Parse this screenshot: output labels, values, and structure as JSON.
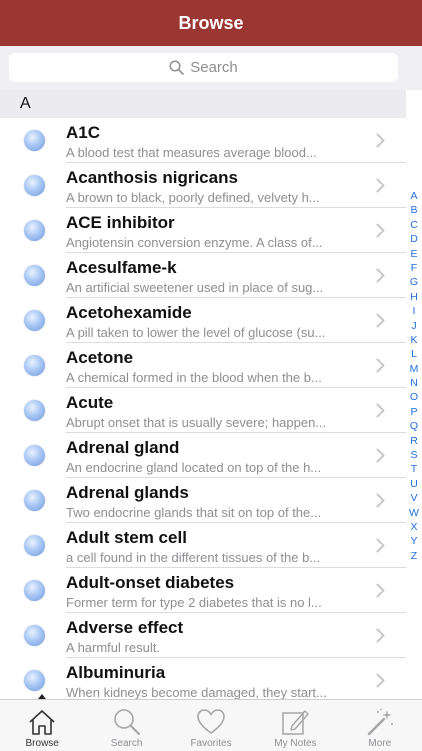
{
  "navbar": {
    "title": "Browse"
  },
  "search": {
    "placeholder": "Search"
  },
  "section": {
    "letter": "A"
  },
  "entries": [
    {
      "term": "A1C",
      "definition": "A blood test that measures average blood..."
    },
    {
      "term": "Acanthosis nigricans",
      "definition": "A brown to black, poorly defined, velvety h..."
    },
    {
      "term": "ACE inhibitor",
      "definition": "Angiotensin conversion enzyme. A class of..."
    },
    {
      "term": "Acesulfame-k",
      "definition": "An artificial sweetener used in place of sug..."
    },
    {
      "term": "Acetohexamide",
      "definition": "A pill taken to lower the level of glucose (su..."
    },
    {
      "term": "Acetone",
      "definition": "A chemical formed in the blood when the b..."
    },
    {
      "term": "Acute",
      "definition": "Abrupt onset that is usually severe; happen..."
    },
    {
      "term": "Adrenal gland",
      "definition": "An endocrine gland located on top of the h..."
    },
    {
      "term": "Adrenal glands",
      "definition": "Two endocrine glands that sit on top of the..."
    },
    {
      "term": "Adult stem cell",
      "definition": "a cell found in the different tissues of the b..."
    },
    {
      "term": "Adult-onset diabetes",
      "definition": "Former term for type 2 diabetes that is no l..."
    },
    {
      "term": "Adverse effect",
      "definition": "A harmful result."
    },
    {
      "term": "Albuminuria",
      "definition": "When kidneys become damaged, they start..."
    }
  ],
  "index_letters": [
    "A",
    "B",
    "C",
    "D",
    "E",
    "F",
    "G",
    "H",
    "I",
    "J",
    "K",
    "L",
    "M",
    "N",
    "O",
    "P",
    "Q",
    "R",
    "S",
    "T",
    "U",
    "V",
    "W",
    "X",
    "Y",
    "Z"
  ],
  "tabs": [
    {
      "label": "Browse",
      "icon": "home-icon",
      "active": true
    },
    {
      "label": "Search",
      "icon": "magnifier-icon",
      "active": false
    },
    {
      "label": "Favorites",
      "icon": "heart-icon",
      "active": false
    },
    {
      "label": "My Notes",
      "icon": "notes-icon",
      "active": false
    },
    {
      "label": "More",
      "icon": "magic-wand-icon",
      "active": false
    }
  ],
  "colors": {
    "navbar": "#9a3733",
    "index_link": "#1f6fe0",
    "definition_text": "#8e8e93"
  }
}
